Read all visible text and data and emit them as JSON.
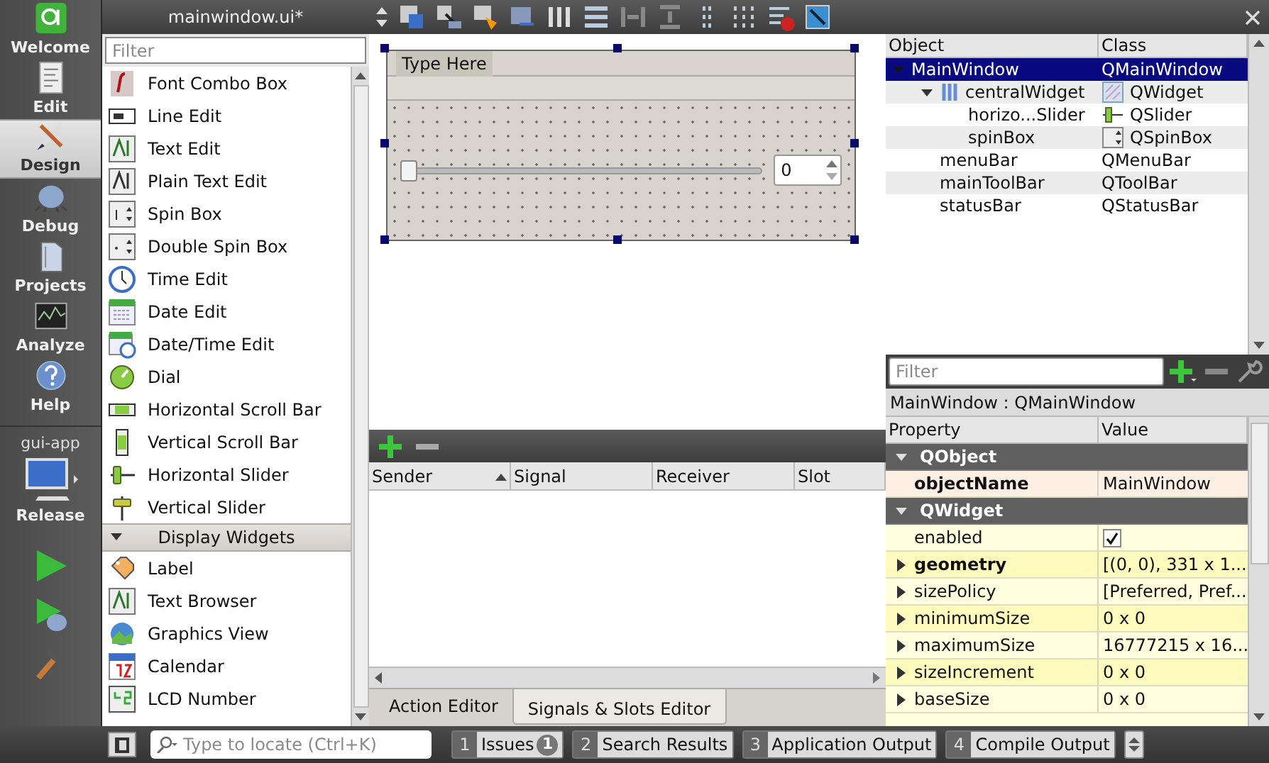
{
  "editor": {
    "title": "mainwindow.ui*"
  },
  "mode_bar": {
    "items": [
      {
        "label": "Welcome",
        "selected": false
      },
      {
        "label": "Edit",
        "selected": false
      },
      {
        "label": "Design",
        "selected": true
      },
      {
        "label": "Debug",
        "selected": false
      },
      {
        "label": "Projects",
        "selected": false
      },
      {
        "label": "Analyze",
        "selected": false
      },
      {
        "label": "Help",
        "selected": false
      }
    ],
    "project": "gui-app",
    "build": "Release"
  },
  "widget_box": {
    "filter_placeholder": "Filter",
    "items": [
      {
        "kind": "widget",
        "label": "Font Combo Box"
      },
      {
        "kind": "widget",
        "label": "Line Edit"
      },
      {
        "kind": "widget",
        "label": "Text Edit"
      },
      {
        "kind": "widget",
        "label": "Plain Text Edit"
      },
      {
        "kind": "widget",
        "label": "Spin Box"
      },
      {
        "kind": "widget",
        "label": "Double Spin Box"
      },
      {
        "kind": "widget",
        "label": "Time Edit"
      },
      {
        "kind": "widget",
        "label": "Date Edit"
      },
      {
        "kind": "widget",
        "label": "Date/Time Edit"
      },
      {
        "kind": "widget",
        "label": "Dial"
      },
      {
        "kind": "widget",
        "label": "Horizontal Scroll Bar"
      },
      {
        "kind": "widget",
        "label": "Vertical Scroll Bar"
      },
      {
        "kind": "widget",
        "label": "Horizontal Slider"
      },
      {
        "kind": "widget",
        "label": "Vertical Slider"
      },
      {
        "kind": "category",
        "label": "Display Widgets",
        "expanded": true
      },
      {
        "kind": "widget",
        "label": "Label"
      },
      {
        "kind": "widget",
        "label": "Text Browser"
      },
      {
        "kind": "widget",
        "label": "Graphics View"
      },
      {
        "kind": "widget",
        "label": "Calendar"
      },
      {
        "kind": "widget",
        "label": "LCD Number"
      }
    ]
  },
  "form": {
    "menu_placeholder": "Type Here",
    "slider": {
      "level": 0
    },
    "spin_box": {
      "value": "0"
    }
  },
  "signal_slot_editor": {
    "columns": [
      {
        "label": "Sender",
        "sorted": true
      },
      {
        "label": "Signal",
        "sorted": false
      },
      {
        "label": "Receiver",
        "sorted": false
      },
      {
        "label": "Slot",
        "sorted": false
      }
    ],
    "tabs": [
      {
        "label": "Action Editor",
        "selected": false
      },
      {
        "label": "Signals & Slots Editor",
        "selected": true
      }
    ]
  },
  "object_inspector": {
    "columns": [
      "Object",
      "Class"
    ],
    "tree": [
      {
        "object": "MainWindow",
        "class": "QMainWindow",
        "selected": true,
        "expanded": true,
        "children": [
          {
            "object": "centralWidget",
            "class": "QWidget",
            "selected": false,
            "expanded": true,
            "children": [
              {
                "object": "horizo...Slider",
                "class": "QSlider",
                "selected": false
              },
              {
                "object": "spinBox",
                "class": "QSpinBox",
                "selected": false
              }
            ]
          },
          {
            "object": "menuBar",
            "class": "QMenuBar",
            "selected": false
          },
          {
            "object": "mainToolBar",
            "class": "QToolBar",
            "selected": false
          },
          {
            "object": "statusBar",
            "class": "QStatusBar",
            "selected": false
          }
        ]
      }
    ]
  },
  "property_editor": {
    "filter_placeholder": "Filter",
    "context": "MainWindow : QMainWindow",
    "columns": [
      "Property",
      "Value"
    ],
    "rows": [
      {
        "kind": "group",
        "name": "QObject",
        "expanded": true
      },
      {
        "kind": "text",
        "name": "objectName",
        "value": "MainWindow",
        "modified": true
      },
      {
        "kind": "group",
        "name": "QWidget",
        "expanded": true
      },
      {
        "kind": "check",
        "name": "enabled",
        "checked": true,
        "modified": false
      },
      {
        "kind": "text",
        "name": "geometry",
        "value": "[(0, 0), 331 x 1...",
        "modified": true,
        "expanded": false
      },
      {
        "kind": "text",
        "name": "sizePolicy",
        "value": "[Preferred, Pref...",
        "modified": false,
        "expanded": false
      },
      {
        "kind": "text",
        "name": "minimumSize",
        "value": "0 x 0",
        "modified": false,
        "expanded": false
      },
      {
        "kind": "text",
        "name": "maximumSize",
        "value": "16777215 x 16...",
        "modified": false,
        "expanded": false
      },
      {
        "kind": "text",
        "name": "sizeIncrement",
        "value": "0 x 0",
        "modified": false,
        "expanded": false
      },
      {
        "kind": "text",
        "name": "baseSize",
        "value": "0 x 0",
        "modified": false,
        "expanded": false
      }
    ]
  },
  "status_bar": {
    "locator_placeholder": "Type to locate (Ctrl+K)",
    "panes": [
      {
        "number": "1",
        "label": "Issues",
        "badge": "1"
      },
      {
        "number": "2",
        "label": "Search Results"
      },
      {
        "number": "3",
        "label": "Application Output"
      },
      {
        "number": "4",
        "label": "Compile Output"
      }
    ]
  }
}
